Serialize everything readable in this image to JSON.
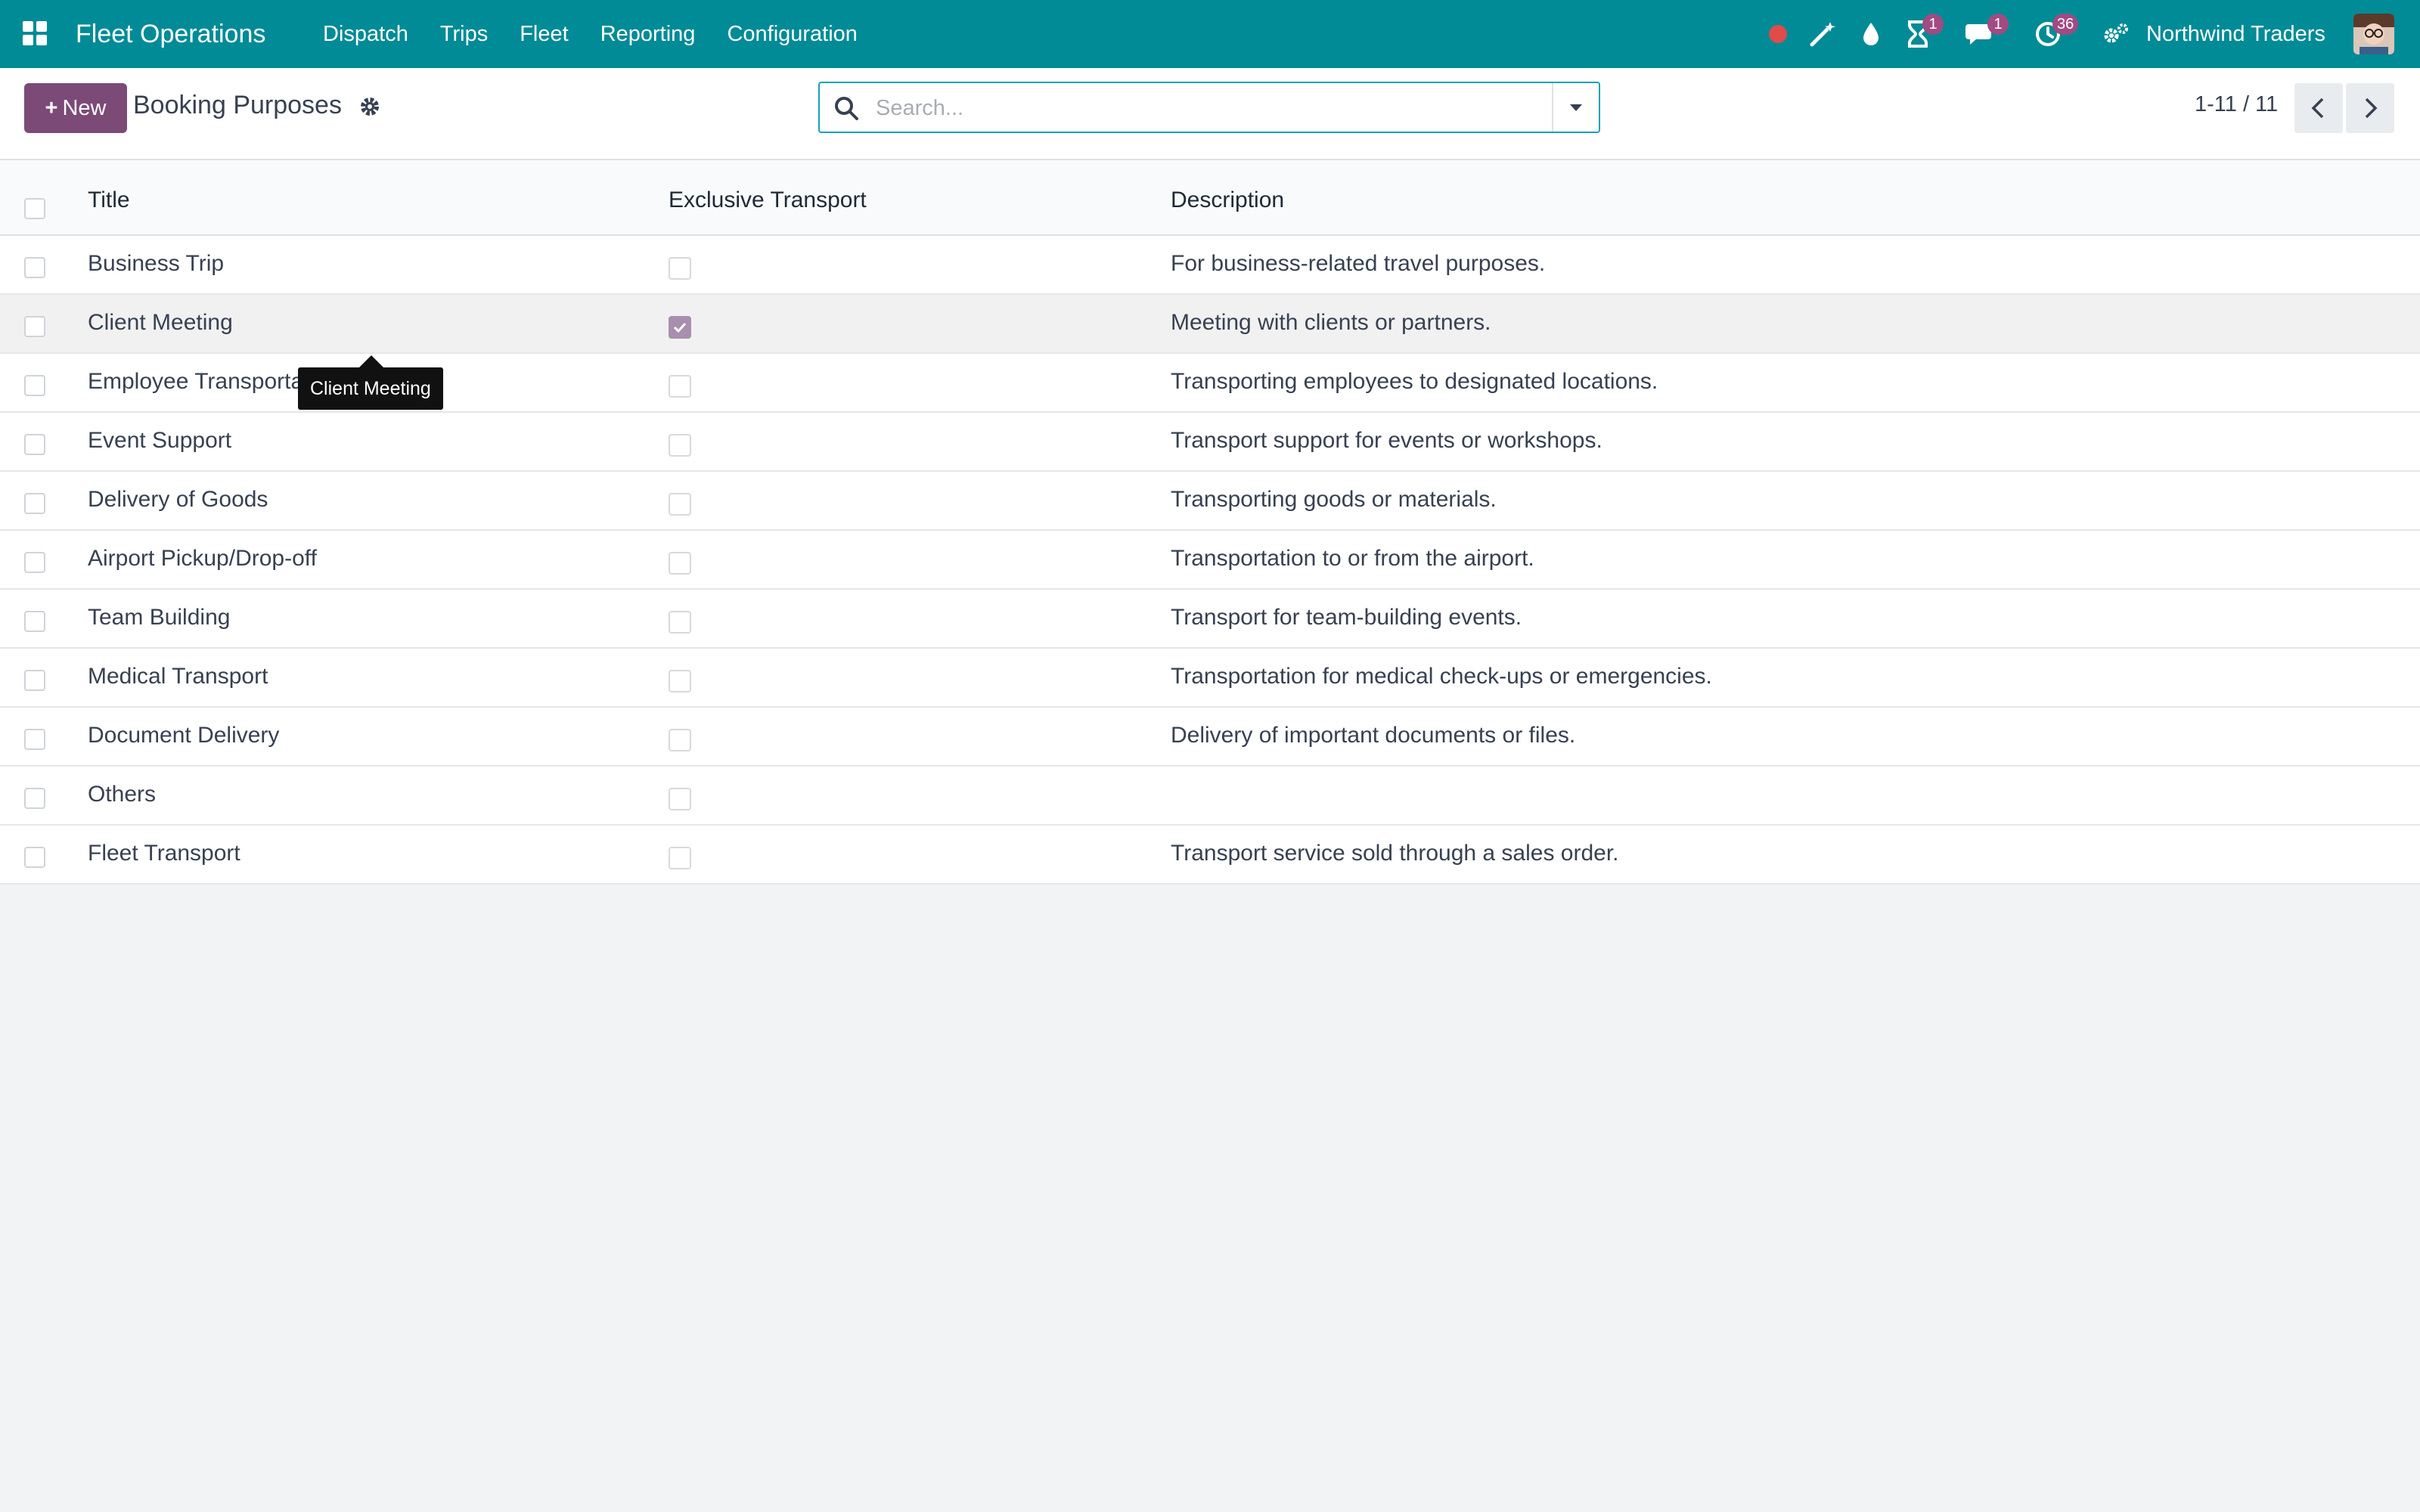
{
  "navbar": {
    "brand": "Fleet Operations",
    "menu": [
      "Dispatch",
      "Trips",
      "Fleet",
      "Reporting",
      "Configuration"
    ],
    "activity_badge": "1",
    "messages_badge": "1",
    "clock_badge": "36",
    "company": "Northwind Traders"
  },
  "control_panel": {
    "new_label": "New",
    "title": "Booking Purposes",
    "search_placeholder": "Search...",
    "pager_value": "1-11 / 11"
  },
  "table": {
    "columns": [
      "Title",
      "Exclusive Transport",
      "Description"
    ],
    "rows": [
      {
        "title": "Business Trip",
        "exclusive": false,
        "description": "For business-related travel purposes."
      },
      {
        "title": "Client Meeting",
        "exclusive": true,
        "description": "Meeting with clients or partners."
      },
      {
        "title": "Employee Transportation",
        "exclusive": false,
        "description": "Transporting employees to designated locations."
      },
      {
        "title": "Event Support",
        "exclusive": false,
        "description": "Transport support for events or workshops."
      },
      {
        "title": "Delivery of Goods",
        "exclusive": false,
        "description": "Transporting goods or materials."
      },
      {
        "title": "Airport Pickup/Drop-off",
        "exclusive": false,
        "description": "Transportation to or from the airport."
      },
      {
        "title": "Team Building",
        "exclusive": false,
        "description": "Transport for team-building events."
      },
      {
        "title": "Medical Transport",
        "exclusive": false,
        "description": "Transportation for medical check-ups or emergencies."
      },
      {
        "title": "Document Delivery",
        "exclusive": false,
        "description": "Delivery of important documents or files."
      },
      {
        "title": "Others",
        "exclusive": false,
        "description": ""
      },
      {
        "title": "Fleet Transport",
        "exclusive": false,
        "description": "Transport service sold through a sales order."
      }
    ]
  },
  "tooltip": {
    "text": "Client Meeting"
  },
  "colors": {
    "navbar": "#008b96",
    "primary_button": "#7c4a77",
    "badge": "#a04b82",
    "record_dot": "#e04b4b"
  }
}
